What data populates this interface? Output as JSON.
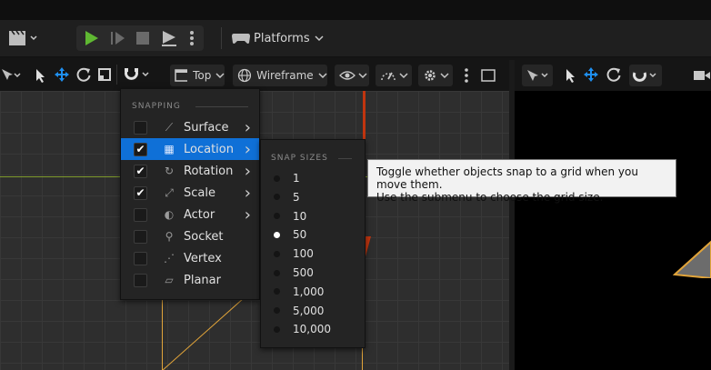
{
  "toolbar": {
    "platforms_label": "Platforms"
  },
  "viewport_toolbar": {
    "view_label": "Top",
    "render_mode_label": "Wireframe"
  },
  "snapping_menu": {
    "header": "SNAPPING",
    "items": [
      {
        "label": "Surface",
        "checked": false,
        "has_submenu": true,
        "icon": "surface-snap-icon"
      },
      {
        "label": "Location",
        "checked": true,
        "has_submenu": true,
        "icon": "grid-snap-icon",
        "selected": true
      },
      {
        "label": "Rotation",
        "checked": true,
        "has_submenu": true,
        "icon": "rotation-snap-icon"
      },
      {
        "label": "Scale",
        "checked": true,
        "has_submenu": true,
        "icon": "scale-snap-icon"
      },
      {
        "label": "Actor",
        "checked": false,
        "has_submenu": true,
        "icon": "actor-snap-icon"
      },
      {
        "label": "Socket",
        "checked": false,
        "has_submenu": false,
        "icon": "socket-snap-icon"
      },
      {
        "label": "Vertex",
        "checked": false,
        "has_submenu": false,
        "icon": "vertex-snap-icon"
      },
      {
        "label": "Planar",
        "checked": false,
        "has_submenu": false,
        "icon": "planar-snap-icon"
      }
    ]
  },
  "snap_sizes": {
    "header": "SNAP SIZES",
    "items": [
      "1",
      "5",
      "10",
      "50",
      "100",
      "500",
      "1,000",
      "5,000",
      "10,000"
    ],
    "selected": "50"
  },
  "tooltip": {
    "line1": "Toggle whether objects snap to a grid when you move them.",
    "line2": "Use the submenu to choose the grid size."
  },
  "colors": {
    "accent": "#0f70d7",
    "play": "#5fb832",
    "gizmo_red": "#c0350f",
    "gizmo_yellow": "#e1a43a",
    "axis_green": "#7e9a2c"
  }
}
